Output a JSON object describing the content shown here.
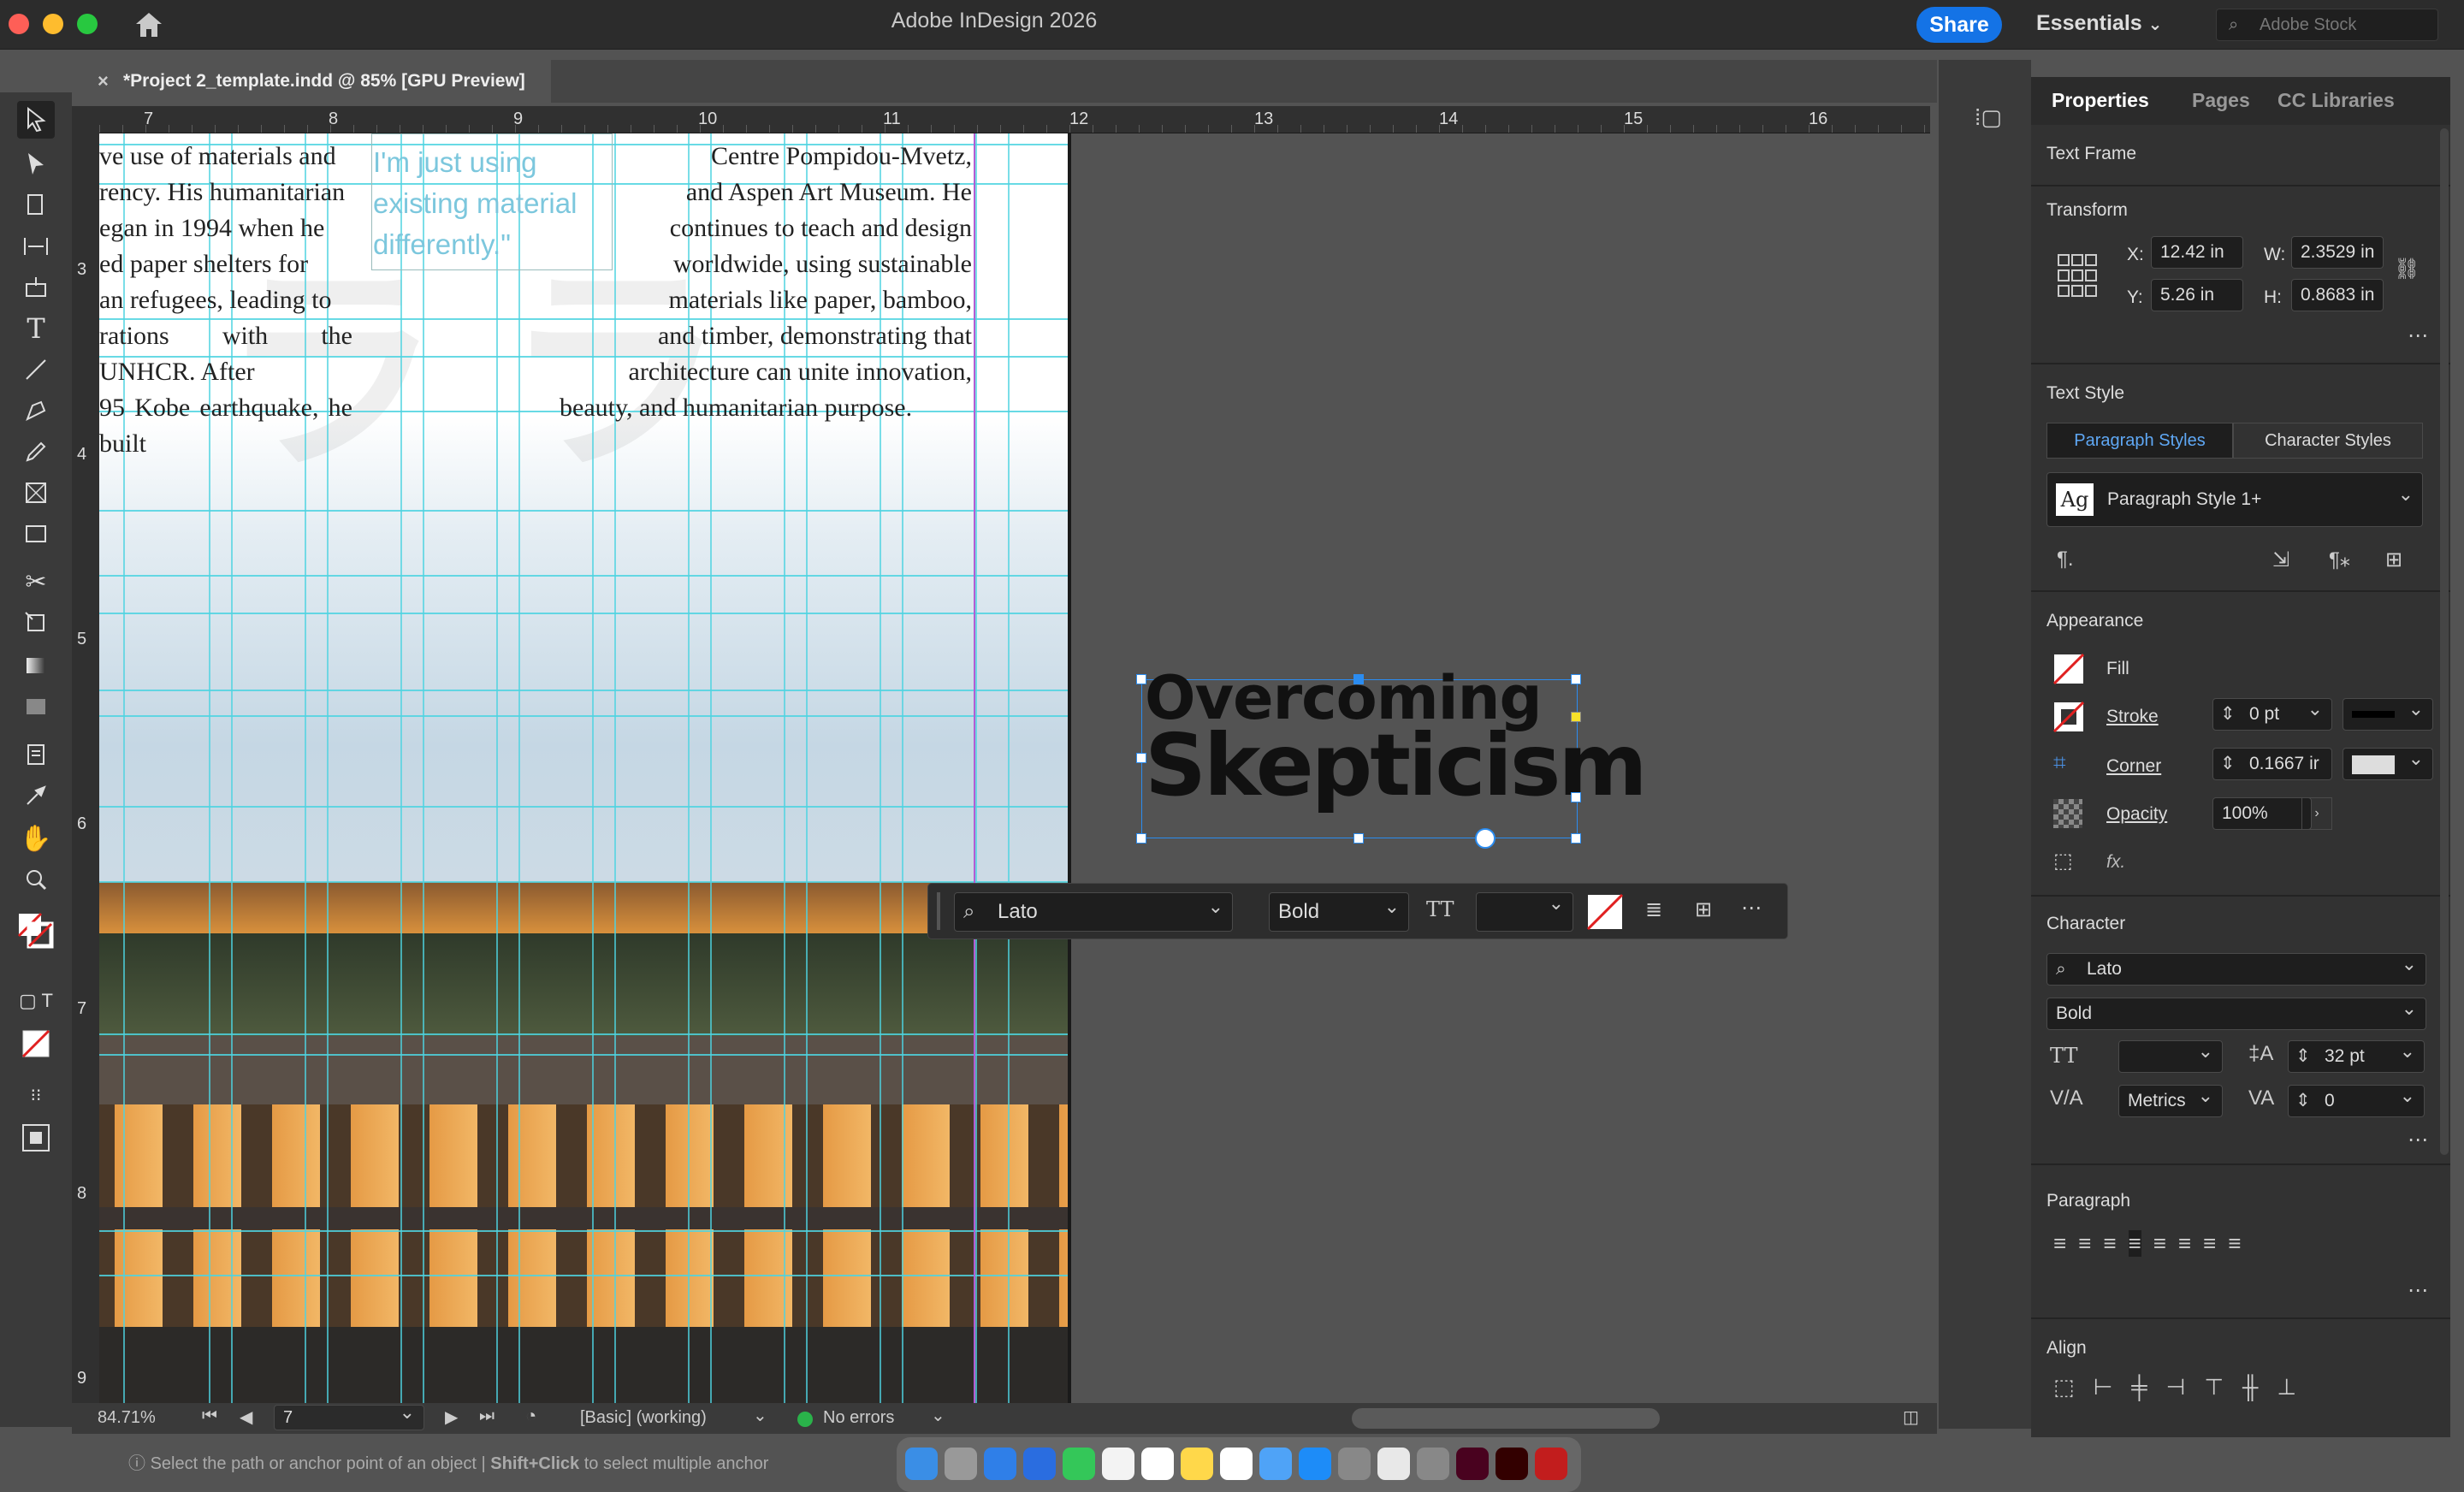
{
  "app": {
    "title": "Adobe InDesign 2026",
    "share_label": "Share",
    "workspace": "Essentials",
    "stock_placeholder": "Adobe Stock"
  },
  "document_tab": {
    "label": "*Project 2_template.indd @ 85% [GPU Preview]",
    "close_icon": "close-icon"
  },
  "ruler": {
    "h_numbers": [
      "7",
      "8",
      "9",
      "10",
      "11",
      "12",
      "13",
      "14",
      "15",
      "16"
    ],
    "v_numbers": [
      "3",
      "4",
      "5",
      "6",
      "7",
      "8",
      "9"
    ]
  },
  "page_text": {
    "left_column": [
      "ve use of materials and",
      "rency. His humanitarian",
      "egan in 1994 when he",
      "ed paper shelters for",
      "an refugees, leading to",
      "rations with the UNHCR. After",
      "95 Kobe earthquake, he built"
    ],
    "right_column": [
      "Centre Pompidou-Mvetz,",
      "and Aspen Art Museum. He",
      "continues to teach and design",
      "worldwide, using sustainable",
      "materials like paper, bamboo,",
      "and timber, demonstrating that",
      "architecture can unite innovation,",
      "beauty, and humanitarian purpose."
    ],
    "quote": [
      "I'm just using",
      "existing material",
      "differently.\""
    ]
  },
  "headline": {
    "line1": "Overcoming",
    "line2": "Skepticism"
  },
  "context_bar": {
    "font": "Lato",
    "style": "Bold"
  },
  "status": {
    "zoom": "84.71%",
    "page": "7",
    "style": "[Basic] (working)",
    "preflight": "No errors",
    "hint_a": "Select the path or anchor point of an object",
    "hint_sep": "|",
    "hint_b": "Shift+Click",
    "hint_c": "to select multiple anchor"
  },
  "panel": {
    "tabs": [
      "Properties",
      "Pages",
      "CC Libraries"
    ],
    "object_type": "Text Frame",
    "transform": {
      "title": "Transform",
      "x_label": "X:",
      "x": "12.42 in",
      "y_label": "Y:",
      "y": "5.26 in",
      "w_label": "W:",
      "w": "2.3529 in",
      "h_label": "H:",
      "h": "0.8683 in"
    },
    "text_style": {
      "title": "Text Style",
      "tab_para": "Paragraph Styles",
      "tab_char": "Character Styles",
      "style_name": "Paragraph Style 1+",
      "ag": "Ag"
    },
    "appearance": {
      "title": "Appearance",
      "fill": "Fill",
      "stroke": "Stroke",
      "stroke_value": "0 pt",
      "corner": "Corner",
      "corner_value": "0.1667 ir",
      "opacity": "Opacity",
      "opacity_value": "100%",
      "fx": "fx."
    },
    "character": {
      "title": "Character",
      "font": "Lato",
      "style": "Bold",
      "leading": "32 pt",
      "kerning": "Metrics",
      "tracking": "0"
    },
    "paragraph": {
      "title": "Paragraph"
    },
    "align": {
      "title": "Align"
    }
  },
  "colors": {
    "accent": "#1473e6",
    "guide": "#4ed3e0",
    "panel_bg": "#323232"
  }
}
